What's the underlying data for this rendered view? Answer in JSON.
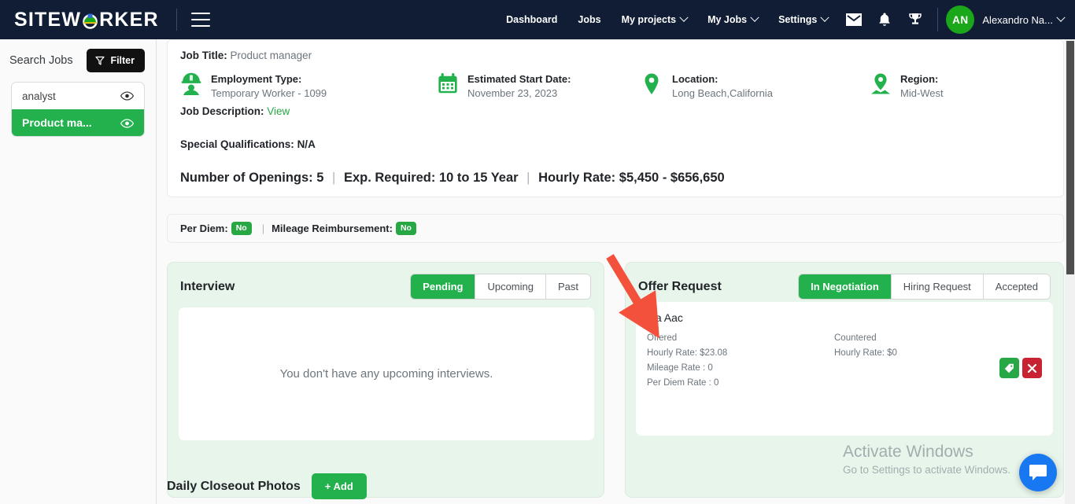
{
  "navbar": {
    "brand": "SITEW RKER",
    "brand_part1": "SITEW",
    "brand_part2": "RKER",
    "menu_toggle": "hamburger-menu",
    "links": [
      {
        "label": "Dashboard",
        "caret": false
      },
      {
        "label": "Jobs",
        "caret": false
      },
      {
        "label": "My projects",
        "caret": true
      },
      {
        "label": "My Jobs",
        "caret": true
      },
      {
        "label": "Settings",
        "caret": true
      }
    ],
    "icons": [
      "mail-icon",
      "bell-icon",
      "trophy-icon"
    ],
    "avatar_initials": "AN",
    "user_name": "Alexandro Na..."
  },
  "sidebar": {
    "title": "Search Jobs",
    "filter_label": "Filter",
    "jobs": [
      {
        "label": "analyst",
        "active": false
      },
      {
        "label": "Product ma...",
        "active": true
      }
    ]
  },
  "job": {
    "title_label": "Job Title:",
    "title_value": "Product manager",
    "employment_label": "Employment Type:",
    "employment_value": "Temporary Worker - 1099",
    "start_label": "Estimated Start Date:",
    "start_value": "November 23, 2023",
    "location_label": "Location:",
    "location_value": "Long Beach,California",
    "region_label": "Region:",
    "region_value": "Mid-West",
    "description_label": "Job Description:",
    "description_link": "View",
    "qualifications_label": "Special Qualifications:",
    "qualifications_value": "N/A",
    "openings_label": "Number of Openings:",
    "openings_value": "5",
    "exp_label": "Exp. Required:",
    "exp_value": "10 to 15 Year",
    "rate_label": "Hourly Rate:",
    "rate_value": "$5,450 - $656,650",
    "per_diem_label": "Per Diem:",
    "per_diem_value": "No",
    "mileage_label": "Mileage Reimbursement:",
    "mileage_value": "No",
    "separator": "|"
  },
  "interview": {
    "title": "Interview",
    "tabs": [
      {
        "label": "Pending",
        "active": true
      },
      {
        "label": "Upcoming",
        "active": false
      },
      {
        "label": "Past",
        "active": false
      }
    ],
    "empty_message": "You don't have any upcoming interviews."
  },
  "offer": {
    "title": "Offer Request",
    "tabs": [
      {
        "label": "In Negotiation",
        "active": true
      },
      {
        "label": "Hiring Request",
        "active": false
      },
      {
        "label": "Accepted",
        "active": false
      }
    ],
    "candidate_name": "Qa Aac",
    "offered_heading": "Offered",
    "offered_rate": "Hourly Rate: $23.08",
    "offered_mileage": "Mileage Rate : 0",
    "offered_perdiem": "Per Diem Rate : 0",
    "countered_heading": "Countered",
    "countered_rate": "Hourly Rate: $0",
    "actions": [
      "tag-icon",
      "close-icon"
    ]
  },
  "closeout": {
    "title": "Daily Closeout Photos",
    "add_label": "+ Add"
  },
  "watermark": {
    "line1": "Activate Windows",
    "line2": "Go to Settings to activate Windows."
  },
  "colors": {
    "navy": "#111d35",
    "green": "#22b14c",
    "green_dark": "#28a745",
    "red": "#c82333",
    "blue": "#1878f2",
    "panel_bg": "#e8f5ea",
    "arrow": "#f4513c"
  }
}
